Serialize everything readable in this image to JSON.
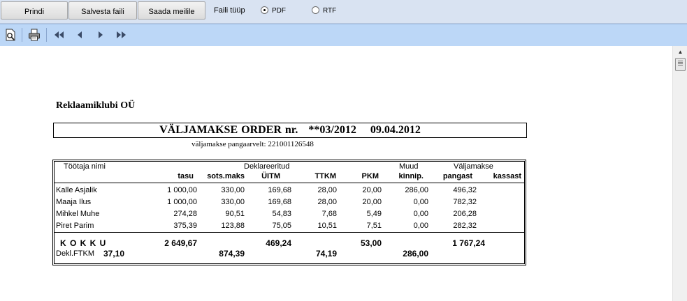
{
  "toolbar": {
    "print": "Prindi",
    "save_file": "Salvesta faili",
    "send_mail": "Saada meilile",
    "file_type_label": "Faili tüüp",
    "options": [
      "PDF",
      "RTF"
    ],
    "selected": "PDF"
  },
  "report_toolbar": {
    "icons": [
      "preview-icon",
      "printer-icon",
      "first-page-icon",
      "previous-page-icon",
      "next-page-icon",
      "last-page-icon"
    ]
  },
  "report": {
    "company": "Reklaamiklubi OÜ",
    "title": "VÄLJAMAKSE ORDER nr.   **03/2012    09.04.2012",
    "bank_account_line": "väljamakse pangaarvelt:  221001126548",
    "headers": {
      "employee": "Töötaja nimi",
      "declared": "Deklareeritud",
      "other": "Muud",
      "payout": "Väljamakse",
      "tasu": "tasu",
      "sots": "sots.maks",
      "uitm": "ÜITM",
      "ttkm": "TTKM",
      "pkm": "PKM",
      "kinnip": "kinnip.",
      "pangast": "pangast",
      "kassast": "kassast"
    },
    "rows": [
      {
        "name": "Kalle Asjalik",
        "tasu": "1 000,00",
        "sots": "330,00",
        "uitm": "169,68",
        "ttkm": "28,00",
        "pkm": "20,00",
        "kinnip": "286,00",
        "pangast": "496,32",
        "kassast": ""
      },
      {
        "name": "Maaja  Ilus",
        "tasu": "1 000,00",
        "sots": "330,00",
        "uitm": "169,68",
        "ttkm": "28,00",
        "pkm": "20,00",
        "kinnip": "0,00",
        "pangast": "782,32",
        "kassast": ""
      },
      {
        "name": "Mihkel  Muhe",
        "tasu": "274,28",
        "sots": "90,51",
        "uitm": "54,83",
        "ttkm": "7,68",
        "pkm": "5,49",
        "kinnip": "0,00",
        "pangast": "206,28",
        "kassast": ""
      },
      {
        "name": "Piret Parim",
        "tasu": "375,39",
        "sots": "123,88",
        "uitm": "75,05",
        "ttkm": "10,51",
        "pkm": "7,51",
        "kinnip": "0,00",
        "pangast": "282,32",
        "kassast": ""
      }
    ],
    "totals": {
      "label": "K O K K U",
      "tasu": "2 649,67",
      "uitm": "469,24",
      "pkm": "53,00",
      "pangast": "1 767,24",
      "ftkm_label": "Dekl.FTKM",
      "ftkm": "37,10",
      "sots": "874,39",
      "ttkm": "74,19",
      "kinnip": "286,00"
    }
  }
}
